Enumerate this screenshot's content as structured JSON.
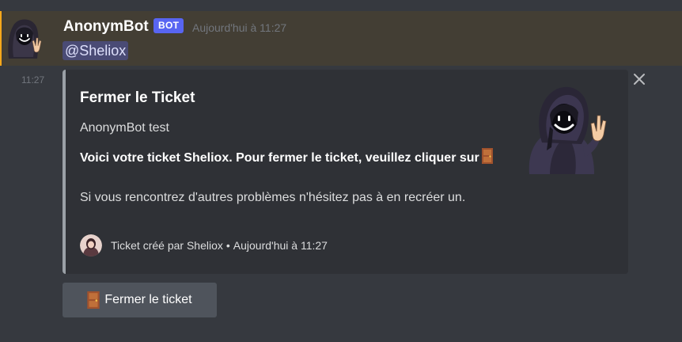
{
  "message": {
    "author": "AnonymBot",
    "badge": "BOT",
    "timestamp": "Aujourd'hui à 11:27",
    "mention": "@Sheliox",
    "side_time": "11:27"
  },
  "embed": {
    "title": "Fermer le Ticket",
    "author_line": "AnonymBot test",
    "bold_text": "Voici votre ticket Sheliox. Pour fermer le ticket, veuillez cliquer sur",
    "description": "Si vous rencontrez d'autres problèmes n'hésitez pas à en recréer un.",
    "footer_text": "Ticket créé par Sheliox",
    "footer_separator": "•",
    "footer_time": "Aujourd'hui à 11:27",
    "accent_color": "#9aa0a6"
  },
  "button": {
    "label": "Fermer le ticket",
    "icon": "door-icon"
  },
  "colors": {
    "background": "#36393f",
    "mention_highlight": "#433e34",
    "bot_badge": "#5865f2",
    "button": "#4f545c"
  }
}
